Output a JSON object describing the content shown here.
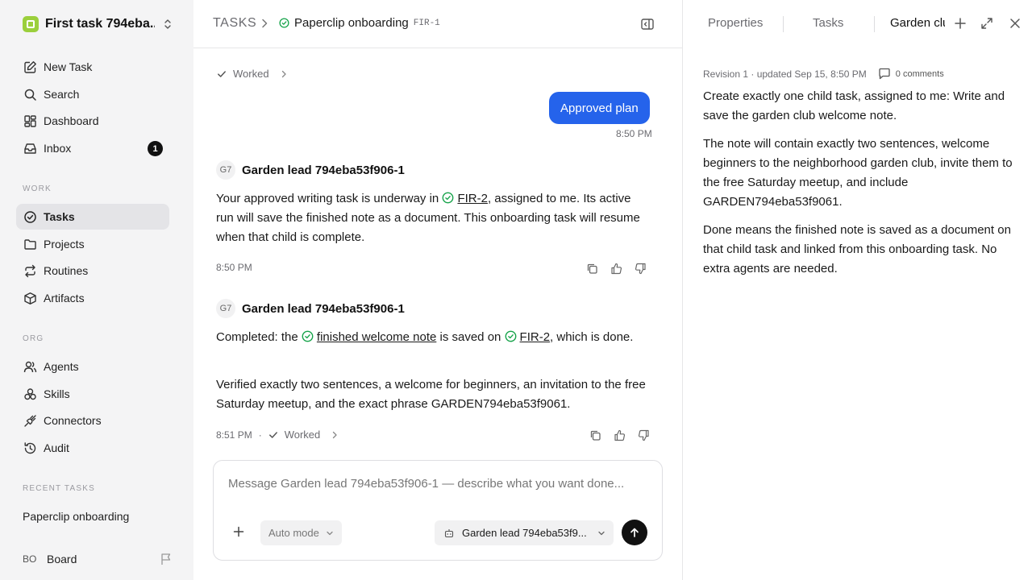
{
  "colors": {
    "accent": "#2563eb",
    "success": "#16a34a",
    "sidebar_bg": "#f4f4f5",
    "active_bg": "#e4e4e7"
  },
  "sidebar": {
    "workspace": {
      "name": "First task 794eba...",
      "icon": "workspace-logo-icon"
    },
    "nav_top": [
      {
        "label": "New Task",
        "icon": "edit-icon"
      },
      {
        "label": "Search",
        "icon": "search-icon"
      },
      {
        "label": "Dashboard",
        "icon": "dashboard-icon"
      },
      {
        "label": "Inbox",
        "icon": "inbox-icon",
        "badge": "1"
      }
    ],
    "work_label": "WORK",
    "work_items": [
      {
        "label": "Tasks",
        "icon": "check-circle-icon",
        "active": true
      },
      {
        "label": "Projects",
        "icon": "folder-icon"
      },
      {
        "label": "Routines",
        "icon": "repeat-icon"
      },
      {
        "label": "Artifacts",
        "icon": "box-icon"
      }
    ],
    "org_label": "ORG",
    "org_items": [
      {
        "label": "Agents",
        "icon": "users-icon"
      },
      {
        "label": "Skills",
        "icon": "skills-icon"
      },
      {
        "label": "Connectors",
        "icon": "plug-icon"
      },
      {
        "label": "Audit",
        "icon": "history-icon"
      }
    ],
    "recent_label": "RECENT TASKS",
    "recent_items": [
      {
        "label": "Paperclip onboarding"
      }
    ],
    "board": {
      "initials": "BO",
      "label": "Board",
      "icon": "flag-icon"
    }
  },
  "header": {
    "section": "TASKS",
    "task_title": "Paperclip onboarding",
    "task_id": "FIR-1",
    "status_icon": "check-circle-icon"
  },
  "conversation": {
    "worked_top": "Worked",
    "user_bubble": {
      "text": "Approved plan",
      "time": "8:50 PM"
    },
    "messages": [
      {
        "avatar": "G7",
        "author": "Garden lead 794eba53f906-1",
        "paragraphs": [
          {
            "t1": "Your approved writing task is underway in ",
            "link1": "FIR-2",
            "t2": ", assigned to me. Its active run will save the finished note as a document. This onboarding task will resume when that child is complete."
          }
        ],
        "time": "8:50 PM"
      },
      {
        "avatar": "G7",
        "author": "Garden lead 794eba53f906-1",
        "p1": {
          "t1": "Completed: the ",
          "link1": "finished welcome note",
          "t2": " is saved on ",
          "link2": "FIR-2",
          "t3": ", which is done."
        },
        "p2": "Verified exactly two sentences, a welcome for beginners, an invitation to the free Saturday meetup, and the exact phrase GARDEN794eba53f9061.",
        "time": "8:51 PM",
        "separator": "·",
        "worked": "Worked"
      }
    ]
  },
  "composer": {
    "placeholder": "Message Garden lead 794eba53f906-1 — describe what you want done...",
    "mode": "Auto mode",
    "agent": "Garden lead 794eba53f9..."
  },
  "right_panel": {
    "tabs": [
      "Properties",
      "Tasks",
      "Garden club welcome note"
    ],
    "revision": "Revision 1 · updated Sep 15, 8:50 PM",
    "comments": "0 comments",
    "paragraphs": [
      "Create exactly one child task, assigned to me: Write and save the garden club welcome note.",
      "The note will contain exactly two sentences, welcome beginners to the neighborhood garden club, invite them to the free Saturday meetup, and include GARDEN794eba53f9061.",
      "Done means the finished note is saved as a document on that child task and linked from this onboarding task. No extra agents are needed."
    ]
  }
}
